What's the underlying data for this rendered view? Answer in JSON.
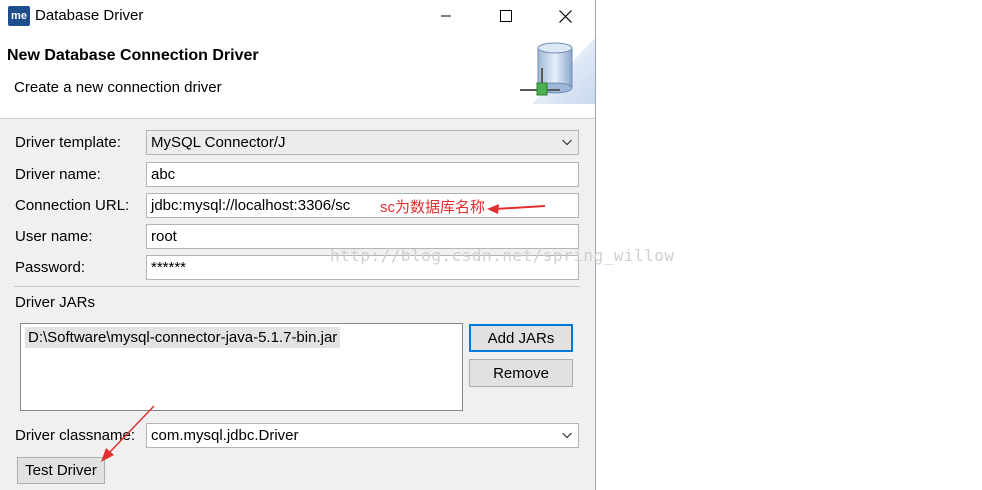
{
  "window": {
    "app_icon_text": "me",
    "title": "Database Driver"
  },
  "header": {
    "title": "New Database Connection Driver",
    "description": "Create a new connection driver"
  },
  "form": {
    "driver_template": {
      "label": "Driver template:",
      "value": "MySQL Connector/J"
    },
    "driver_name": {
      "label": "Driver name:",
      "value": "abc"
    },
    "connection_url": {
      "label": "Connection URL:",
      "value": "jdbc:mysql://localhost:3306/sc"
    },
    "user_name": {
      "label": "User name:",
      "value": "root"
    },
    "password": {
      "label": "Password:",
      "value": "******"
    }
  },
  "jars": {
    "label": "Driver JARs",
    "items": [
      "D:\\Software\\mysql-connector-java-5.1.7-bin.jar"
    ],
    "add_button": "Add JARs",
    "remove_button": "Remove"
  },
  "classname": {
    "label": "Driver classname:",
    "value": "com.mysql.jdbc.Driver"
  },
  "test_button": "Test Driver",
  "annotation": "sc为数据库名称",
  "watermark": "http://blog.csdn.net/spring_willow",
  "colors": {
    "annotation": "#e03030",
    "default_button_border": "#0078d7"
  }
}
